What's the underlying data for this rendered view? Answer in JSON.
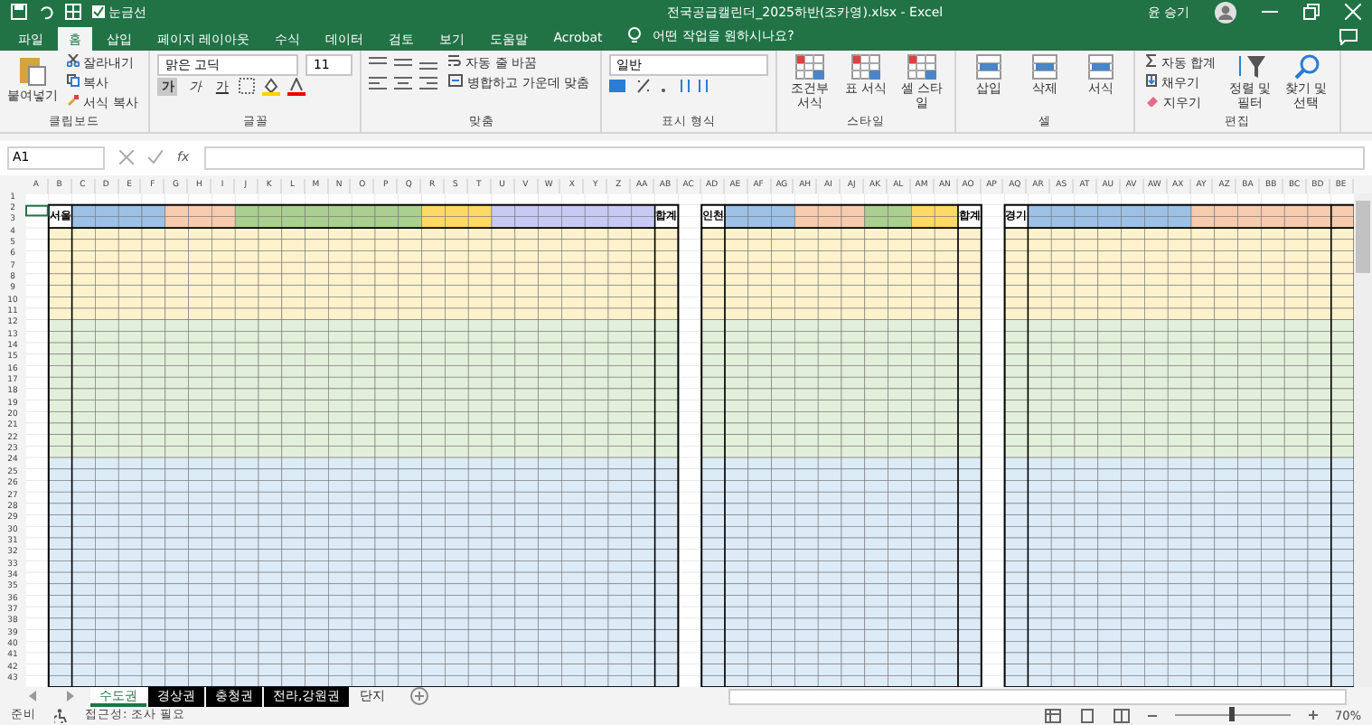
{
  "window": {
    "title": "전국공급캘린더_2025하반(조카영).xlsx - Excel",
    "account": "윤 승기"
  },
  "quick_access": {
    "gridlines_label": "눈금선",
    "gridlines_checked": true
  },
  "tabs": [
    {
      "label": "파일",
      "selected": false
    },
    {
      "label": "홈",
      "selected": true
    },
    {
      "label": "삽입",
      "selected": false
    },
    {
      "label": "페이지 레이아웃",
      "selected": false
    },
    {
      "label": "수식",
      "selected": false
    },
    {
      "label": "데이터",
      "selected": false
    },
    {
      "label": "검토",
      "selected": false
    },
    {
      "label": "보기",
      "selected": false
    },
    {
      "label": "도움말",
      "selected": false
    },
    {
      "label": "Acrobat",
      "selected": false
    }
  ],
  "tell_me": "어떤 작업을 원하시나요?",
  "ribbon": {
    "clipboard": {
      "paste": "붙여넣기",
      "cut": "잘라내기",
      "copy": "복사",
      "format_painter": "서식 복사",
      "label": "클립보드"
    },
    "font": {
      "name": "맑은 고딕",
      "size": "11",
      "bold": "가",
      "italic": "가",
      "underline": "가",
      "label": "글꼴"
    },
    "alignment": {
      "wrap": "자동 줄 바꿈",
      "merge": "병합하고 가운데 맞춤",
      "label": "맞춤"
    },
    "number": {
      "format": "일반",
      "label": "표시 형식"
    },
    "styles": {
      "items": [
        "조건부 서식",
        "표 서식",
        "셀 스타일"
      ],
      "label": "스타일"
    },
    "cells": {
      "items": [
        "삽입",
        "삭제",
        "서식"
      ],
      "label": "셀"
    },
    "editing": {
      "autosum": "자동 합계",
      "fill": "채우기",
      "clear": "지우기",
      "sort": "정렬 및 필터",
      "find": "찾기 및 선택",
      "label": "편집"
    }
  },
  "name_box": "A1",
  "formula_fx": "fx",
  "column_headers": [
    "A",
    "B",
    "C",
    "D",
    "E",
    "F",
    "G",
    "H",
    "I",
    "J",
    "K",
    "L",
    "M",
    "N",
    "O",
    "P",
    "Q",
    "R",
    "S",
    "T",
    "U",
    "V",
    "W",
    "X",
    "Y",
    "Z",
    "AA",
    "AB",
    "AC",
    "AD",
    "AE",
    "AF",
    "AG",
    "AH",
    "AI",
    "AJ",
    "AK",
    "AL",
    "AM",
    "AN",
    "AO",
    "AP",
    "AQ",
    "AR",
    "AS",
    "AT",
    "AU",
    "AV",
    "AW",
    "AX",
    "AY",
    "AZ",
    "BA",
    "BB",
    "BC",
    "BD",
    "BE"
  ],
  "row_numbers": [
    "1",
    "2",
    "3",
    "4",
    "5",
    "6",
    "7",
    "8",
    "9",
    "10",
    "11",
    "12",
    "13",
    "14",
    "15",
    "16",
    "17",
    "18",
    "19",
    "20",
    "21",
    "22",
    "23",
    "24",
    "25",
    "26",
    "27",
    "28",
    "29",
    "30",
    "31",
    "32",
    "33",
    "34",
    "35",
    "36",
    "37",
    "38",
    "39",
    "40",
    "41",
    "42",
    "43"
  ],
  "tables": [
    {
      "title": "서울",
      "total": "합계"
    },
    {
      "title": "인천",
      "total": "합계"
    },
    {
      "title": "경기"
    }
  ],
  "sheet_tabs": [
    {
      "label": "수도권",
      "selected": true
    },
    {
      "label": "경상권",
      "selected": false
    },
    {
      "label": "충청권",
      "selected": false
    },
    {
      "label": "전라,강원권",
      "selected": false
    },
    {
      "label": "단지",
      "selected": false
    }
  ],
  "status_bar": {
    "ready": "준비",
    "accessibility": "접근성: 조사 필요",
    "zoom": "70%",
    "zoom_slider": {
      "level": 0.5
    }
  }
}
